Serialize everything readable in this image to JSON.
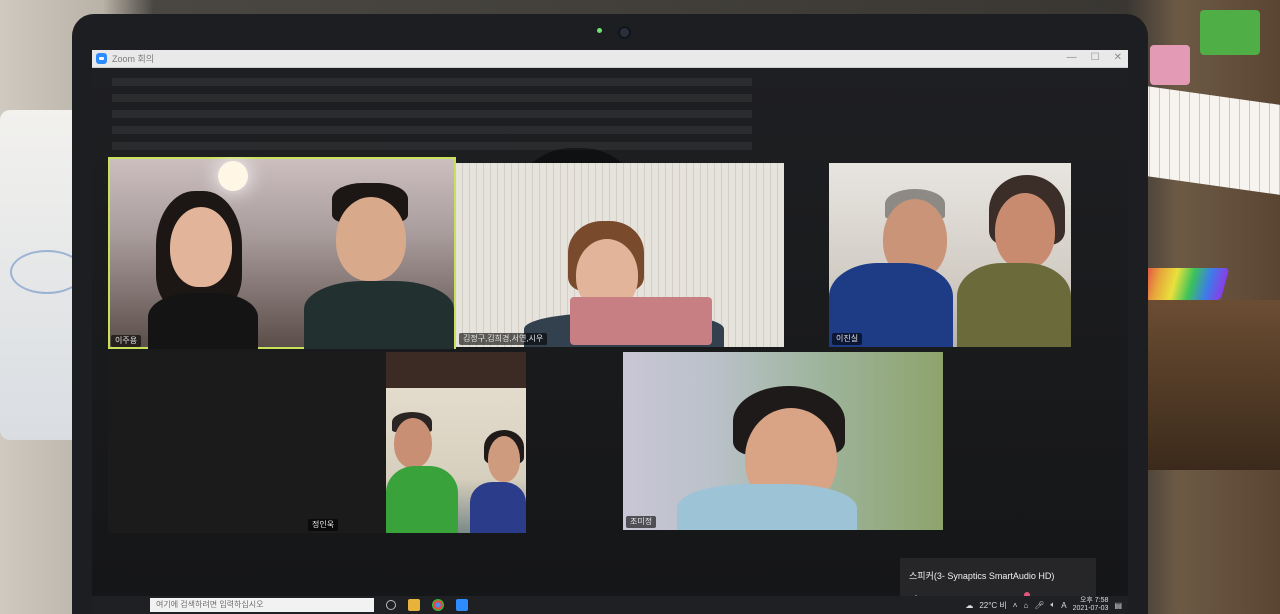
{
  "window": {
    "title": "Zoom 회의"
  },
  "participants": [
    {
      "id": "p1",
      "name": "이주용",
      "active": true
    },
    {
      "id": "p2",
      "name": "김정구,김희경,서연,시우",
      "active": false
    },
    {
      "id": "p3",
      "name": "이진실",
      "active": false
    },
    {
      "id": "p4",
      "name": "정인욱",
      "active": false
    },
    {
      "id": "p5",
      "name": "조미정",
      "active": false
    }
  ],
  "volume": {
    "device": "스피커(3- Synaptics SmartAudio HD)",
    "level": 62,
    "level_fraction": 0.62
  },
  "taskbar": {
    "search_placeholder": "여기에 검색하려면 입력하십시오",
    "weather": "22°C 비",
    "language": "A",
    "time": "오후 7:58",
    "date": "2021-07-03"
  },
  "colors": {
    "active_speaker": "#c8e05a",
    "volume_accent": "#e0557d",
    "zoom_blue": "#2d8cff"
  }
}
